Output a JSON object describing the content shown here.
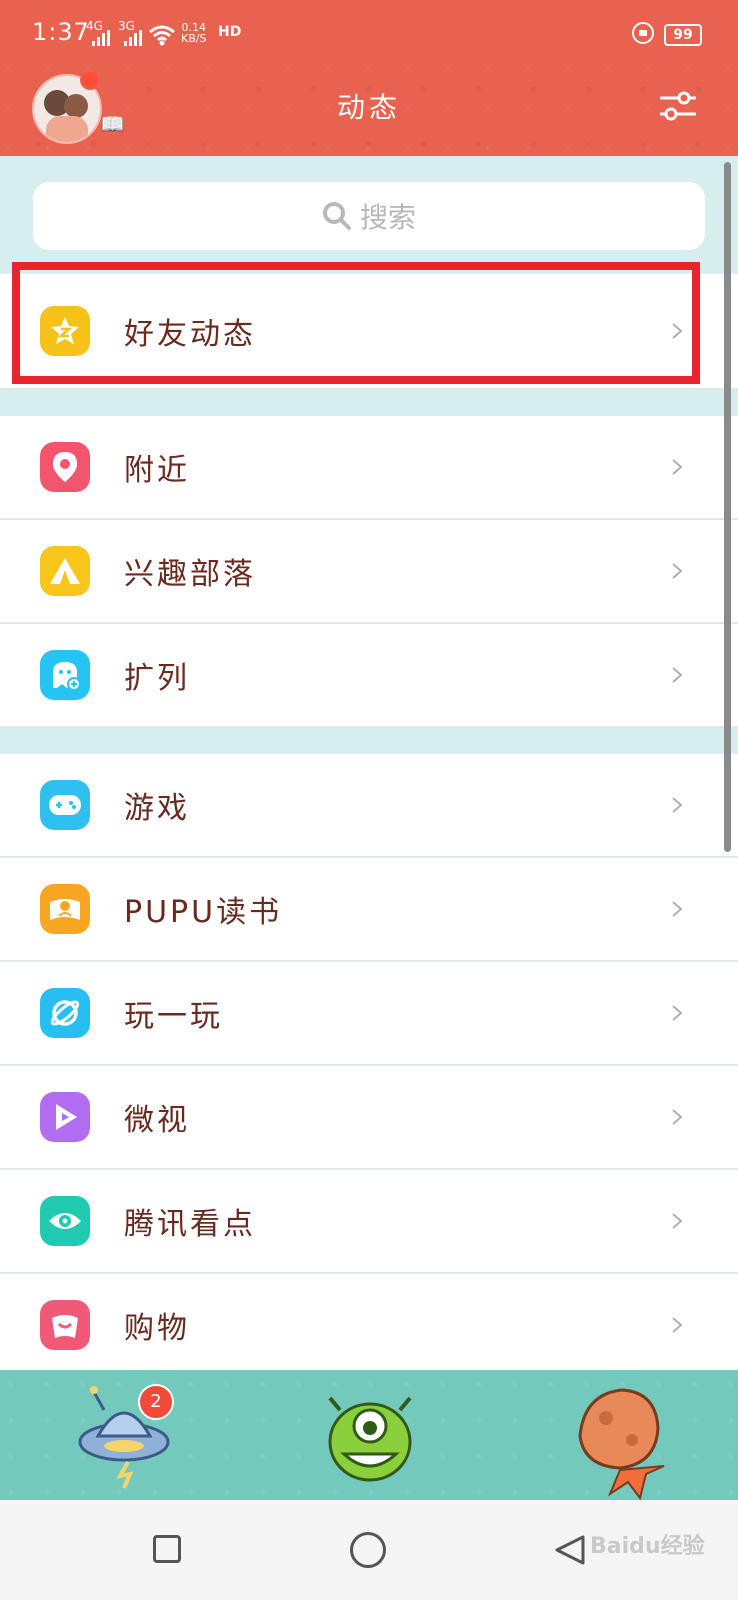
{
  "status_bar": {
    "time": "1:37",
    "net1": "4G",
    "net2": "3G",
    "speed_value": "0.14",
    "speed_unit": "KB/S",
    "hd": "HD",
    "battery": "99"
  },
  "header": {
    "title": "动态"
  },
  "search": {
    "placeholder": "搜索"
  },
  "list": {
    "highlighted_index": 0,
    "groups": [
      [
        {
          "label": "好友动态",
          "icon": "star-icon",
          "color": "#f6c21a"
        }
      ],
      [
        {
          "label": "附近",
          "icon": "location-pin-icon",
          "color": "#f2566f"
        },
        {
          "label": "兴趣部落",
          "icon": "tent-icon",
          "color": "#f7c51c"
        },
        {
          "label": "扩列",
          "icon": "ghost-add-icon",
          "color": "#25c4f2"
        }
      ],
      [
        {
          "label": "游戏",
          "icon": "gamepad-icon",
          "color": "#2fc0f0"
        },
        {
          "label": "PUPU读书",
          "icon": "book-icon",
          "color": "#f8a622"
        },
        {
          "label": "玩一玩",
          "icon": "planet-icon",
          "color": "#27bff2"
        },
        {
          "label": "微视",
          "icon": "play-icon",
          "color": "#b26cf0"
        },
        {
          "label": "腾讯看点",
          "icon": "eye-icon",
          "color": "#1fcab0"
        },
        {
          "label": "购物",
          "icon": "shopping-bag-icon",
          "color": "#f05a77"
        }
      ]
    ]
  },
  "tabbar": {
    "badge": "2",
    "tabs": [
      "ufo-tab-icon",
      "alien-tab-icon",
      "rock-tab-icon"
    ]
  },
  "navbar": {
    "watermark": "Baidu经验"
  }
}
